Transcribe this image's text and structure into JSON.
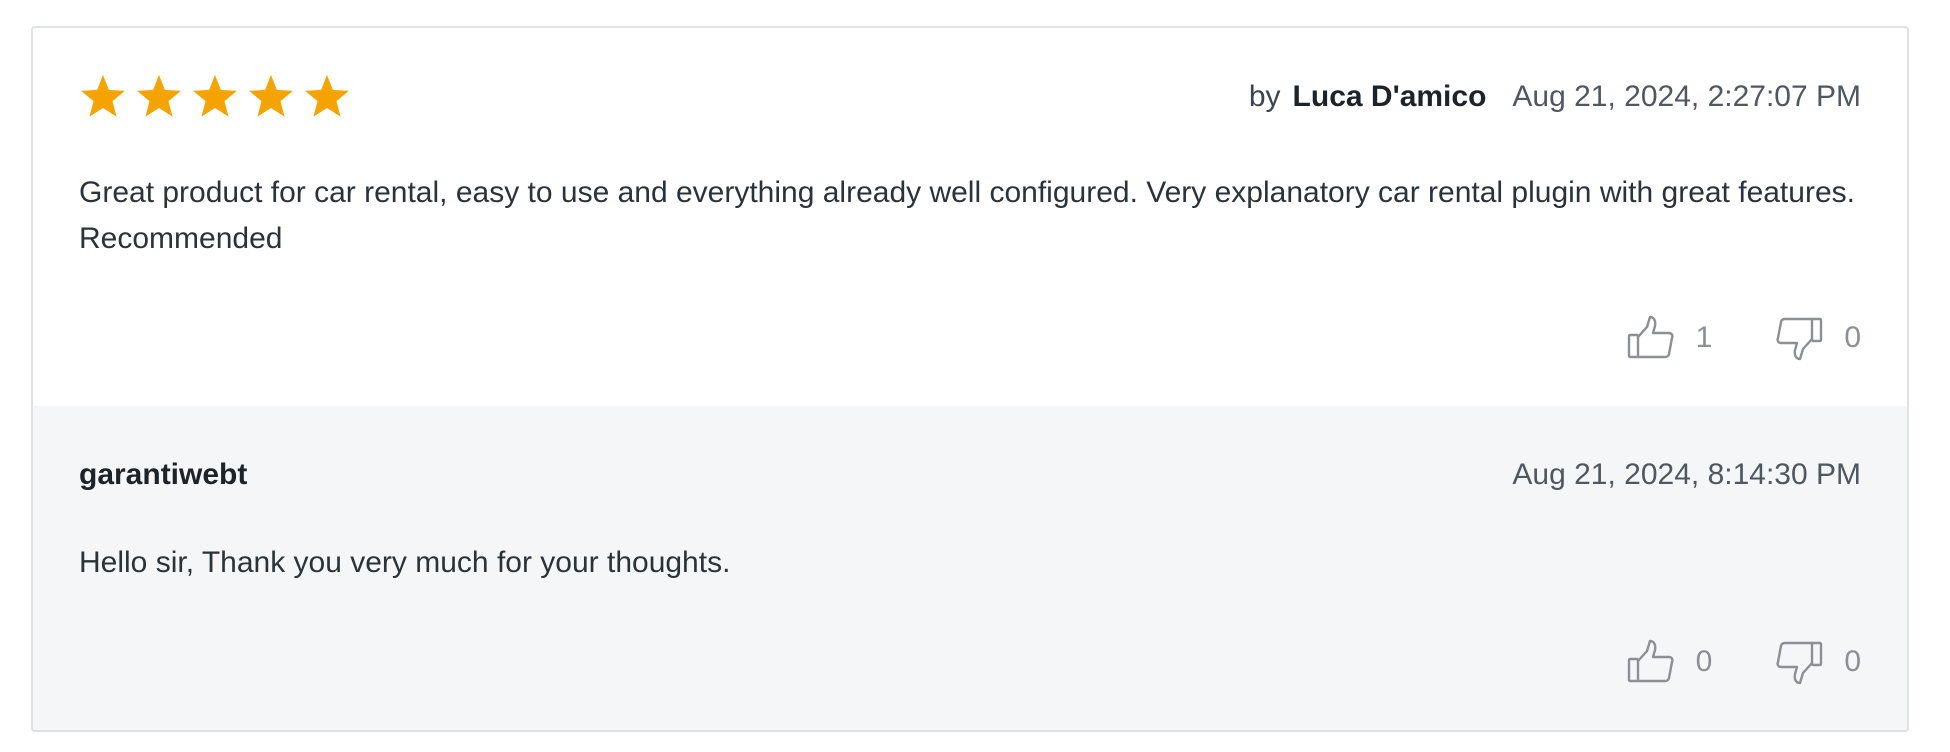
{
  "review": {
    "rating": 5,
    "rating_max": 5,
    "star_color": "#f4a300",
    "by_label": "by",
    "author": "Luca D'amico",
    "date": "Aug 21, 2024, 2:27:07 PM",
    "text": "Great product for car rental, easy to use and everything already well configured. Very explanatory car rental plugin with great features. Recommended",
    "upvotes": "1",
    "downvotes": "0"
  },
  "reply": {
    "author": "garantiwebt",
    "date": "Aug 21, 2024, 8:14:30 PM",
    "text": "Hello sir, Thank you very much for your thoughts.",
    "upvotes": "0",
    "downvotes": "0"
  },
  "icons": {
    "star": "star-icon",
    "thumbs_up": "thumbs-up-icon",
    "thumbs_down": "thumbs-down-icon"
  }
}
